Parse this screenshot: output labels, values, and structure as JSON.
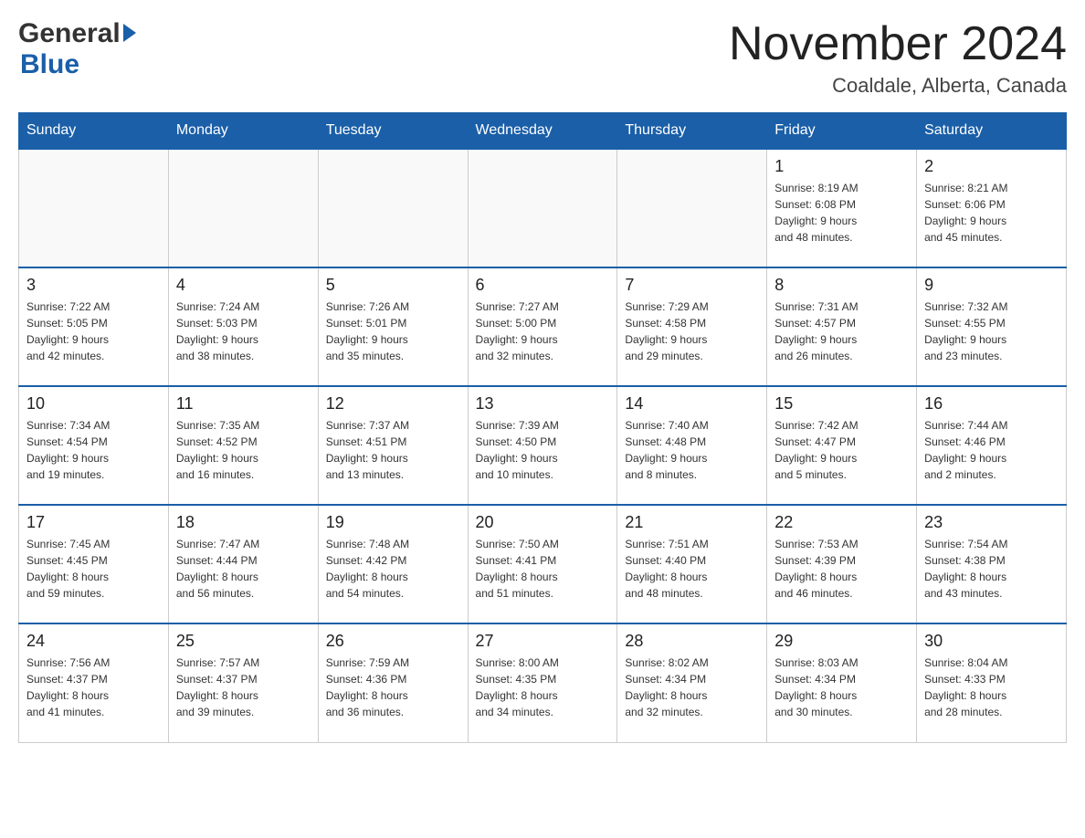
{
  "header": {
    "logo": {
      "general": "General",
      "blue": "Blue"
    },
    "month_title": "November 2024",
    "location": "Coaldale, Alberta, Canada"
  },
  "weekdays": [
    "Sunday",
    "Monday",
    "Tuesday",
    "Wednesday",
    "Thursday",
    "Friday",
    "Saturday"
  ],
  "weeks": [
    [
      {
        "day": "",
        "info": ""
      },
      {
        "day": "",
        "info": ""
      },
      {
        "day": "",
        "info": ""
      },
      {
        "day": "",
        "info": ""
      },
      {
        "day": "",
        "info": ""
      },
      {
        "day": "1",
        "info": "Sunrise: 8:19 AM\nSunset: 6:08 PM\nDaylight: 9 hours\nand 48 minutes."
      },
      {
        "day": "2",
        "info": "Sunrise: 8:21 AM\nSunset: 6:06 PM\nDaylight: 9 hours\nand 45 minutes."
      }
    ],
    [
      {
        "day": "3",
        "info": "Sunrise: 7:22 AM\nSunset: 5:05 PM\nDaylight: 9 hours\nand 42 minutes."
      },
      {
        "day": "4",
        "info": "Sunrise: 7:24 AM\nSunset: 5:03 PM\nDaylight: 9 hours\nand 38 minutes."
      },
      {
        "day": "5",
        "info": "Sunrise: 7:26 AM\nSunset: 5:01 PM\nDaylight: 9 hours\nand 35 minutes."
      },
      {
        "day": "6",
        "info": "Sunrise: 7:27 AM\nSunset: 5:00 PM\nDaylight: 9 hours\nand 32 minutes."
      },
      {
        "day": "7",
        "info": "Sunrise: 7:29 AM\nSunset: 4:58 PM\nDaylight: 9 hours\nand 29 minutes."
      },
      {
        "day": "8",
        "info": "Sunrise: 7:31 AM\nSunset: 4:57 PM\nDaylight: 9 hours\nand 26 minutes."
      },
      {
        "day": "9",
        "info": "Sunrise: 7:32 AM\nSunset: 4:55 PM\nDaylight: 9 hours\nand 23 minutes."
      }
    ],
    [
      {
        "day": "10",
        "info": "Sunrise: 7:34 AM\nSunset: 4:54 PM\nDaylight: 9 hours\nand 19 minutes."
      },
      {
        "day": "11",
        "info": "Sunrise: 7:35 AM\nSunset: 4:52 PM\nDaylight: 9 hours\nand 16 minutes."
      },
      {
        "day": "12",
        "info": "Sunrise: 7:37 AM\nSunset: 4:51 PM\nDaylight: 9 hours\nand 13 minutes."
      },
      {
        "day": "13",
        "info": "Sunrise: 7:39 AM\nSunset: 4:50 PM\nDaylight: 9 hours\nand 10 minutes."
      },
      {
        "day": "14",
        "info": "Sunrise: 7:40 AM\nSunset: 4:48 PM\nDaylight: 9 hours\nand 8 minutes."
      },
      {
        "day": "15",
        "info": "Sunrise: 7:42 AM\nSunset: 4:47 PM\nDaylight: 9 hours\nand 5 minutes."
      },
      {
        "day": "16",
        "info": "Sunrise: 7:44 AM\nSunset: 4:46 PM\nDaylight: 9 hours\nand 2 minutes."
      }
    ],
    [
      {
        "day": "17",
        "info": "Sunrise: 7:45 AM\nSunset: 4:45 PM\nDaylight: 8 hours\nand 59 minutes."
      },
      {
        "day": "18",
        "info": "Sunrise: 7:47 AM\nSunset: 4:44 PM\nDaylight: 8 hours\nand 56 minutes."
      },
      {
        "day": "19",
        "info": "Sunrise: 7:48 AM\nSunset: 4:42 PM\nDaylight: 8 hours\nand 54 minutes."
      },
      {
        "day": "20",
        "info": "Sunrise: 7:50 AM\nSunset: 4:41 PM\nDaylight: 8 hours\nand 51 minutes."
      },
      {
        "day": "21",
        "info": "Sunrise: 7:51 AM\nSunset: 4:40 PM\nDaylight: 8 hours\nand 48 minutes."
      },
      {
        "day": "22",
        "info": "Sunrise: 7:53 AM\nSunset: 4:39 PM\nDaylight: 8 hours\nand 46 minutes."
      },
      {
        "day": "23",
        "info": "Sunrise: 7:54 AM\nSunset: 4:38 PM\nDaylight: 8 hours\nand 43 minutes."
      }
    ],
    [
      {
        "day": "24",
        "info": "Sunrise: 7:56 AM\nSunset: 4:37 PM\nDaylight: 8 hours\nand 41 minutes."
      },
      {
        "day": "25",
        "info": "Sunrise: 7:57 AM\nSunset: 4:37 PM\nDaylight: 8 hours\nand 39 minutes."
      },
      {
        "day": "26",
        "info": "Sunrise: 7:59 AM\nSunset: 4:36 PM\nDaylight: 8 hours\nand 36 minutes."
      },
      {
        "day": "27",
        "info": "Sunrise: 8:00 AM\nSunset: 4:35 PM\nDaylight: 8 hours\nand 34 minutes."
      },
      {
        "day": "28",
        "info": "Sunrise: 8:02 AM\nSunset: 4:34 PM\nDaylight: 8 hours\nand 32 minutes."
      },
      {
        "day": "29",
        "info": "Sunrise: 8:03 AM\nSunset: 4:34 PM\nDaylight: 8 hours\nand 30 minutes."
      },
      {
        "day": "30",
        "info": "Sunrise: 8:04 AM\nSunset: 4:33 PM\nDaylight: 8 hours\nand 28 minutes."
      }
    ]
  ]
}
